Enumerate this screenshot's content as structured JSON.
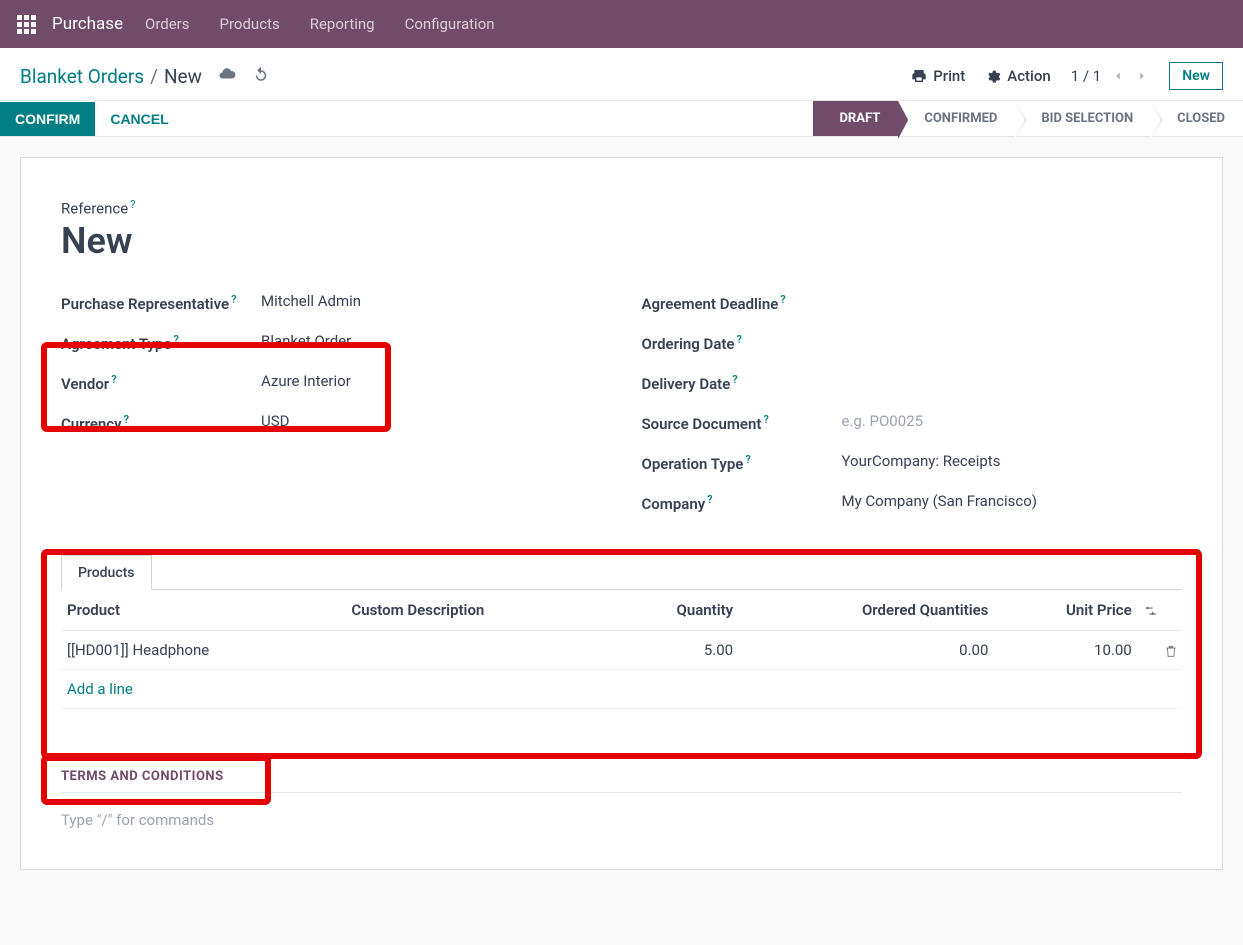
{
  "nav": {
    "brand": "Purchase",
    "items": [
      "Orders",
      "Products",
      "Reporting",
      "Configuration"
    ]
  },
  "breadcrumb": {
    "link": "Blanket Orders",
    "sep": "/",
    "current": "New"
  },
  "subheader": {
    "print": "Print",
    "action": "Action",
    "pager": "1 / 1",
    "new": "New"
  },
  "actions": {
    "confirm": "CONFIRM",
    "cancel": "CANCEL"
  },
  "status": {
    "steps": [
      "DRAFT",
      "CONFIRMED",
      "BID SELECTION",
      "CLOSED"
    ]
  },
  "form": {
    "refLabel": "Reference",
    "title": "New",
    "left": {
      "rep_label": "Purchase Representative",
      "rep_value": "Mitchell Admin",
      "agreement_label": "Agreement Type",
      "agreement_value": "Blanket Order",
      "vendor_label": "Vendor",
      "vendor_value": "Azure Interior",
      "currency_label": "Currency",
      "currency_value": "USD"
    },
    "right": {
      "deadline_label": "Agreement Deadline",
      "ordering_label": "Ordering Date",
      "delivery_label": "Delivery Date",
      "source_label": "Source Document",
      "source_placeholder": "e.g. PO0025",
      "operation_label": "Operation Type",
      "operation_value": "YourCompany: Receipts",
      "company_label": "Company",
      "company_value": "My Company (San Francisco)"
    }
  },
  "tabs": {
    "products": "Products"
  },
  "table": {
    "h_product": "Product",
    "h_desc": "Custom Description",
    "h_qty": "Quantity",
    "h_ordered": "Ordered Quantities",
    "h_price": "Unit Price",
    "rows": [
      {
        "product": "[[HD001]] Headphone",
        "desc": "",
        "qty": "5.00",
        "ordered": "0.00",
        "price": "10.00"
      }
    ],
    "add": "Add a line"
  },
  "terms": {
    "title": "TERMS AND CONDITIONS",
    "placeholder": "Type \"/\" for commands"
  }
}
